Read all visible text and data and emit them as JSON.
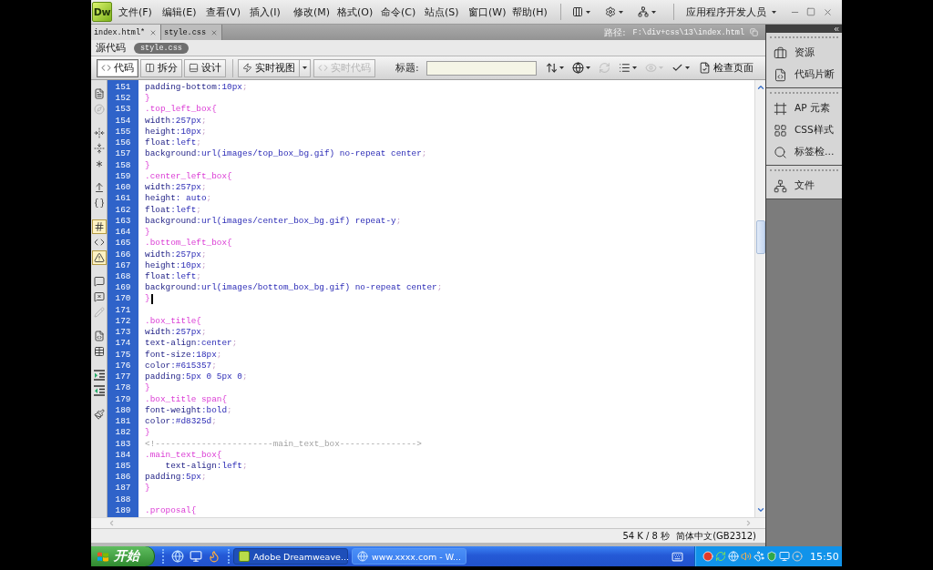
{
  "app": {
    "logo": "Dw"
  },
  "menu_bar": {
    "items": [
      "文件(F)",
      "编辑(E)",
      "查看(V)",
      "插入(I)",
      "修改(M)",
      "格式(O)",
      "命令(C)",
      "站点(S)",
      "窗口(W)",
      "帮助(H)"
    ],
    "workspace": "应用程序开发人员"
  },
  "document_tabs": [
    {
      "label": "index.html*",
      "selected": true
    },
    {
      "label": "style.css",
      "selected": false
    }
  ],
  "path": {
    "label": "路径:",
    "value": "F:\\div+css\\13\\index.html"
  },
  "related_files": [
    {
      "label": "源代码",
      "selected": false
    },
    {
      "label": "style.css",
      "selected": true
    }
  ],
  "document_toolbar": {
    "view_buttons": [
      {
        "label": "代码",
        "selected": true
      },
      {
        "label": "拆分",
        "selected": false
      },
      {
        "label": "设计",
        "selected": false
      }
    ],
    "live_view": "实时视图",
    "live_code": {
      "label": "实时代码",
      "disabled": true
    },
    "title_label": "标题:",
    "tools": [
      {
        "kind": "transfer",
        "disabled": false
      },
      {
        "kind": "preview",
        "disabled": false
      },
      {
        "kind": "refresh",
        "disabled": true
      },
      {
        "kind": "view_options",
        "disabled": false
      },
      {
        "kind": "visual_aids",
        "disabled": true
      },
      {
        "kind": "validate",
        "disabled": false
      }
    ],
    "check_page": "检查页面"
  },
  "coding_toolbar": {
    "groups": [
      {
        "buttons": [
          {
            "kind": "documents",
            "disabled": false,
            "pressed": false
          },
          {
            "kind": "navigator",
            "disabled": true,
            "pressed": false
          }
        ]
      },
      {
        "buttons": [
          {
            "kind": "collapse_tag",
            "disabled": false,
            "pressed": false
          },
          {
            "kind": "collapse_selection",
            "disabled": false,
            "pressed": false
          },
          {
            "kind": "expand_all",
            "disabled": false,
            "pressed": false
          }
        ]
      },
      {
        "buttons": [
          {
            "kind": "select_parent",
            "disabled": false,
            "pressed": false
          },
          {
            "kind": "balance_braces",
            "disabled": false,
            "pressed": false
          }
        ]
      },
      {
        "buttons": [
          {
            "kind": "line_numbers",
            "disabled": false,
            "pressed": true
          },
          {
            "kind": "highlight_invalid",
            "disabled": false,
            "pressed": false
          },
          {
            "kind": "syntax_check",
            "disabled": false,
            "pressed": true
          }
        ]
      },
      {
        "buttons": [
          {
            "kind": "apply_comment",
            "disabled": false,
            "pressed": false
          },
          {
            "kind": "remove_comment",
            "disabled": false,
            "pressed": false
          },
          {
            "kind": "wrap_tag",
            "disabled": true,
            "pressed": false
          }
        ]
      },
      {
        "buttons": [
          {
            "kind": "snippets",
            "disabled": false,
            "pressed": false
          },
          {
            "kind": "move_css",
            "disabled": false,
            "pressed": false
          }
        ]
      },
      {
        "buttons": [
          {
            "kind": "indent",
            "disabled": false,
            "pressed": false
          },
          {
            "kind": "outdent",
            "disabled": false,
            "pressed": false
          }
        ]
      },
      {
        "buttons": [
          {
            "kind": "format",
            "disabled": false,
            "pressed": false
          }
        ]
      }
    ]
  },
  "code_lines": [
    {
      "number": "151",
      "caret": false,
      "tokens": [
        {
          "kind": "property",
          "text": "padding-bottom"
        },
        {
          "kind": "value",
          "text": ":10px"
        },
        {
          "kind": "punct",
          "text": ";"
        }
      ]
    },
    {
      "number": "152",
      "caret": false,
      "tokens": [
        {
          "kind": "brace",
          "text": "}"
        }
      ]
    },
    {
      "number": "153",
      "caret": false,
      "tokens": [
        {
          "kind": "selector",
          "text": ".top_left_box{"
        }
      ]
    },
    {
      "number": "154",
      "caret": false,
      "tokens": [
        {
          "kind": "property",
          "text": "width"
        },
        {
          "kind": "value",
          "text": ":257px"
        },
        {
          "kind": "punct",
          "text": ";"
        }
      ]
    },
    {
      "number": "155",
      "caret": false,
      "tokens": [
        {
          "kind": "property",
          "text": "height"
        },
        {
          "kind": "value",
          "text": ":10px"
        },
        {
          "kind": "punct",
          "text": ";"
        }
      ]
    },
    {
      "number": "156",
      "caret": false,
      "tokens": [
        {
          "kind": "property",
          "text": "float"
        },
        {
          "kind": "value",
          "text": ":left"
        },
        {
          "kind": "punct",
          "text": ";"
        }
      ]
    },
    {
      "number": "157",
      "caret": false,
      "tokens": [
        {
          "kind": "property",
          "text": "background"
        },
        {
          "kind": "value",
          "text": ":url(images/top_box_bg.gif) no-repeat center"
        },
        {
          "kind": "punct",
          "text": ";"
        }
      ]
    },
    {
      "number": "158",
      "caret": false,
      "tokens": [
        {
          "kind": "brace",
          "text": "}"
        }
      ]
    },
    {
      "number": "159",
      "caret": false,
      "tokens": [
        {
          "kind": "selector",
          "text": ".center_left_box{"
        }
      ]
    },
    {
      "number": "160",
      "caret": false,
      "tokens": [
        {
          "kind": "property",
          "text": "width"
        },
        {
          "kind": "value",
          "text": ":257px"
        },
        {
          "kind": "punct",
          "text": ";"
        }
      ]
    },
    {
      "number": "161",
      "caret": false,
      "tokens": [
        {
          "kind": "property",
          "text": "height"
        },
        {
          "kind": "value",
          "text": ": auto"
        },
        {
          "kind": "punct",
          "text": ";"
        }
      ]
    },
    {
      "number": "162",
      "caret": false,
      "tokens": [
        {
          "kind": "property",
          "text": "float"
        },
        {
          "kind": "value",
          "text": ":left"
        },
        {
          "kind": "punct",
          "text": ";"
        }
      ]
    },
    {
      "number": "163",
      "caret": false,
      "tokens": [
        {
          "kind": "property",
          "text": "background"
        },
        {
          "kind": "value",
          "text": ":url(images/center_box_bg.gif) repeat-y"
        },
        {
          "kind": "punct",
          "text": ";"
        }
      ]
    },
    {
      "number": "164",
      "caret": false,
      "tokens": [
        {
          "kind": "brace",
          "text": "}"
        }
      ]
    },
    {
      "number": "165",
      "caret": false,
      "tokens": [
        {
          "kind": "selector",
          "text": ".bottom_left_box{"
        }
      ]
    },
    {
      "number": "166",
      "caret": false,
      "tokens": [
        {
          "kind": "property",
          "text": "width"
        },
        {
          "kind": "value",
          "text": ":257px"
        },
        {
          "kind": "punct",
          "text": ";"
        }
      ]
    },
    {
      "number": "167",
      "caret": false,
      "tokens": [
        {
          "kind": "property",
          "text": "height"
        },
        {
          "kind": "value",
          "text": ":10px"
        },
        {
          "kind": "punct",
          "text": ";"
        }
      ]
    },
    {
      "number": "168",
      "caret": false,
      "tokens": [
        {
          "kind": "property",
          "text": "float"
        },
        {
          "kind": "value",
          "text": ":left"
        },
        {
          "kind": "punct",
          "text": ";"
        }
      ]
    },
    {
      "number": "169",
      "caret": false,
      "tokens": [
        {
          "kind": "property",
          "text": "background"
        },
        {
          "kind": "value",
          "text": ":url(images/bottom_box_bg.gif) no-repeat center"
        },
        {
          "kind": "punct",
          "text": ";"
        }
      ]
    },
    {
      "number": "170",
      "caret": true,
      "tokens": [
        {
          "kind": "brace",
          "text": "}"
        }
      ]
    },
    {
      "number": "171",
      "caret": false
    },
    {
      "number": "172",
      "caret": false,
      "tokens": [
        {
          "kind": "selector",
          "text": ".box_title{"
        }
      ]
    },
    {
      "number": "173",
      "caret": false,
      "tokens": [
        {
          "kind": "property",
          "text": "width"
        },
        {
          "kind": "value",
          "text": ":257px"
        },
        {
          "kind": "punct",
          "text": ";"
        }
      ]
    },
    {
      "number": "174",
      "caret": false,
      "tokens": [
        {
          "kind": "property",
          "text": "text-align"
        },
        {
          "kind": "value",
          "text": ":center"
        },
        {
          "kind": "punct",
          "text": ";"
        }
      ]
    },
    {
      "number": "175",
      "caret": false,
      "tokens": [
        {
          "kind": "property",
          "text": "font-size"
        },
        {
          "kind": "value",
          "text": ":18px"
        },
        {
          "kind": "punct",
          "text": ";"
        }
      ]
    },
    {
      "number": "176",
      "caret": false,
      "tokens": [
        {
          "kind": "property",
          "text": "color"
        },
        {
          "kind": "value",
          "text": ":#615357"
        },
        {
          "kind": "punct",
          "text": ";"
        }
      ]
    },
    {
      "number": "177",
      "caret": false,
      "tokens": [
        {
          "kind": "property",
          "text": "padding"
        },
        {
          "kind": "value",
          "text": ":5px 0 5px 0"
        },
        {
          "kind": "punct",
          "text": ";"
        }
      ]
    },
    {
      "number": "178",
      "caret": false,
      "tokens": [
        {
          "kind": "brace",
          "text": "}"
        }
      ]
    },
    {
      "number": "179",
      "caret": false,
      "tokens": [
        {
          "kind": "selector",
          "text": ".box_title span{"
        }
      ]
    },
    {
      "number": "180",
      "caret": false,
      "tokens": [
        {
          "kind": "property",
          "text": "font-weight"
        },
        {
          "kind": "value",
          "text": ":bold"
        },
        {
          "kind": "punct",
          "text": ";"
        }
      ]
    },
    {
      "number": "181",
      "caret": false,
      "tokens": [
        {
          "kind": "property",
          "text": "color"
        },
        {
          "kind": "value",
          "text": ":#d8325d"
        },
        {
          "kind": "punct",
          "text": ";"
        }
      ]
    },
    {
      "number": "182",
      "caret": false,
      "tokens": [
        {
          "kind": "brace",
          "text": "}"
        }
      ]
    },
    {
      "number": "183",
      "caret": false,
      "tokens": [
        {
          "kind": "comment",
          "text": "<!-----------------------main_text_box--------------->"
        }
      ]
    },
    {
      "number": "184",
      "caret": false,
      "tokens": [
        {
          "kind": "selector",
          "text": ".main_text_box{"
        }
      ]
    },
    {
      "number": "185",
      "caret": false,
      "tokens": [
        {
          "kind": "property",
          "text": "    text-align"
        },
        {
          "kind": "value",
          "text": ":left"
        },
        {
          "kind": "punct",
          "text": ";"
        }
      ]
    },
    {
      "number": "186",
      "caret": false,
      "tokens": [
        {
          "kind": "property",
          "text": "padding"
        },
        {
          "kind": "value",
          "text": ":5px"
        },
        {
          "kind": "punct",
          "text": ";"
        }
      ]
    },
    {
      "number": "187",
      "caret": false,
      "tokens": [
        {
          "kind": "brace",
          "text": "}"
        }
      ]
    },
    {
      "number": "188",
      "caret": false
    },
    {
      "number": "189",
      "caret": false,
      "tokens": [
        {
          "kind": "selector",
          "text": ".proposal{"
        }
      ]
    }
  ],
  "status_bar": {
    "size_time": "54 K / 8 秒",
    "encoding": "简体中文(GB2312)"
  },
  "panel_groups": [
    {
      "items": [
        {
          "kind": "assets",
          "label": "资源"
        },
        {
          "kind": "snippets",
          "label": "代码片断"
        }
      ]
    },
    {
      "items": [
        {
          "kind": "ap_elements",
          "label": "AP 元素"
        },
        {
          "kind": "css_styles",
          "label": "CSS样式"
        },
        {
          "kind": "tag_inspector",
          "label": "标签检…"
        }
      ]
    },
    {
      "items": [
        {
          "kind": "files",
          "label": "文件"
        }
      ]
    }
  ],
  "taskbar": {
    "start": "开始",
    "tasks": [
      {
        "kind": "editor",
        "label": "Adobe Dreamweave...",
        "selected": true
      },
      {
        "kind": "browser",
        "label": "www.xxxx.com - W...",
        "selected": false
      }
    ],
    "clock": "15:50"
  }
}
